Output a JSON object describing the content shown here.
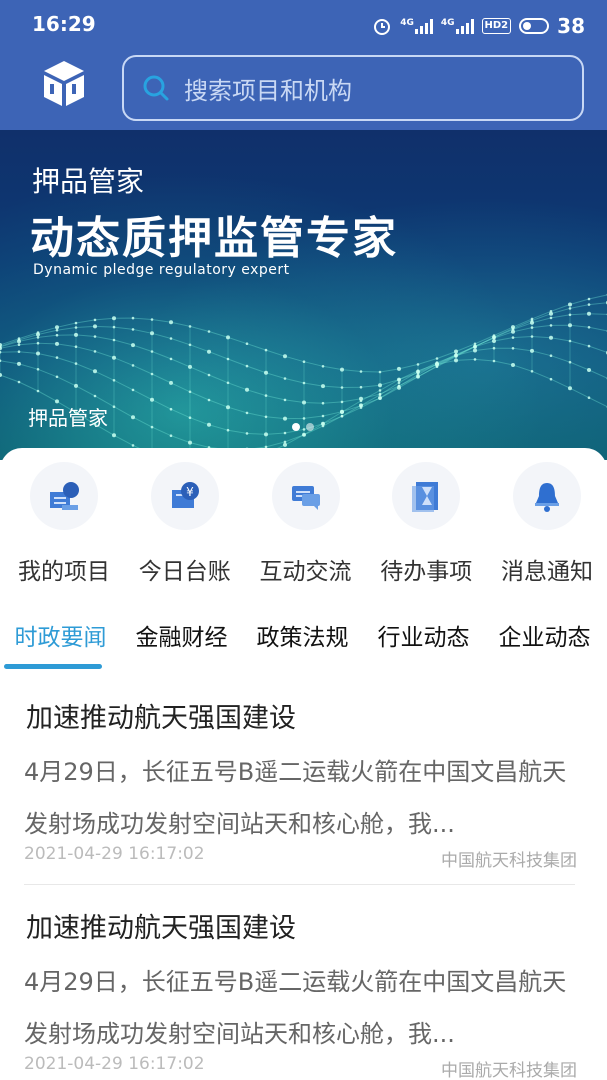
{
  "status": {
    "time": "16:29",
    "battery": "38",
    "net1": "4G",
    "net2": "4G",
    "hd": "HD2"
  },
  "search": {
    "placeholder": "搜索项目和机构"
  },
  "banner": {
    "subtitle": "押品管家",
    "title": "动态质押监管专家",
    "english": "Dynamic pledge regulatory expert",
    "caption": "押品管家",
    "pages": 2,
    "active_page": 1
  },
  "quick": [
    {
      "label": "我的项目",
      "icon": "project-icon"
    },
    {
      "label": "今日台账",
      "icon": "ledger-icon"
    },
    {
      "label": "互动交流",
      "icon": "chat-icon"
    },
    {
      "label": "待办事项",
      "icon": "hourglass-icon"
    },
    {
      "label": "消息通知",
      "icon": "bell-icon"
    }
  ],
  "tabs": [
    {
      "label": "时政要闻",
      "active": true
    },
    {
      "label": "金融财经",
      "active": false
    },
    {
      "label": "政策法规",
      "active": false
    },
    {
      "label": "行业动态",
      "active": false
    },
    {
      "label": "企业动态",
      "active": false
    }
  ],
  "news": [
    {
      "title": "加速推动航天强国建设",
      "desc": "4月29日，长征五号B遥二运载火箭在中国文昌航天发射场成功发射空间站天和核心舱，我...",
      "date": "2021-04-29 16:17:02",
      "source": "中国航天科技集团"
    },
    {
      "title": "加速推动航天强国建设",
      "desc": "4月29日，长征五号B遥二运载火箭在中国文昌航天发射场成功发射空间站天和核心舱，我...",
      "date": "2021-04-29 16:17:02",
      "source": "中国航天科技集团"
    }
  ],
  "colors": {
    "header": "#3d64b6",
    "accent": "#2e9bd6",
    "icon_blue": "#2f6fd0"
  }
}
